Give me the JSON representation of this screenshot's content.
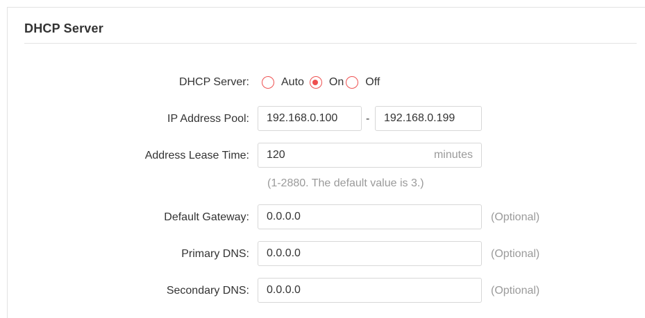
{
  "section": {
    "title": "DHCP Server"
  },
  "dhcp_server": {
    "label": "DHCP Server:",
    "options": [
      {
        "label": "Auto",
        "checked": false
      },
      {
        "label": "On",
        "checked": true
      },
      {
        "label": "Off",
        "checked": false
      }
    ],
    "accent_color": "#ee4f4f"
  },
  "ip_pool": {
    "label": "IP Address Pool:",
    "start": "192.168.0.100",
    "separator": "-",
    "end": "192.168.0.199"
  },
  "lease_time": {
    "label": "Address Lease Time:",
    "value": "120",
    "unit": "minutes",
    "hint": "(1-2880. The default value is 3.)"
  },
  "default_gateway": {
    "label": "Default Gateway:",
    "value": "0.0.0.0",
    "note": "(Optional)"
  },
  "primary_dns": {
    "label": "Primary DNS:",
    "value": "0.0.0.0",
    "note": "(Optional)"
  },
  "secondary_dns": {
    "label": "Secondary DNS:",
    "value": "0.0.0.0",
    "note": "(Optional)"
  }
}
